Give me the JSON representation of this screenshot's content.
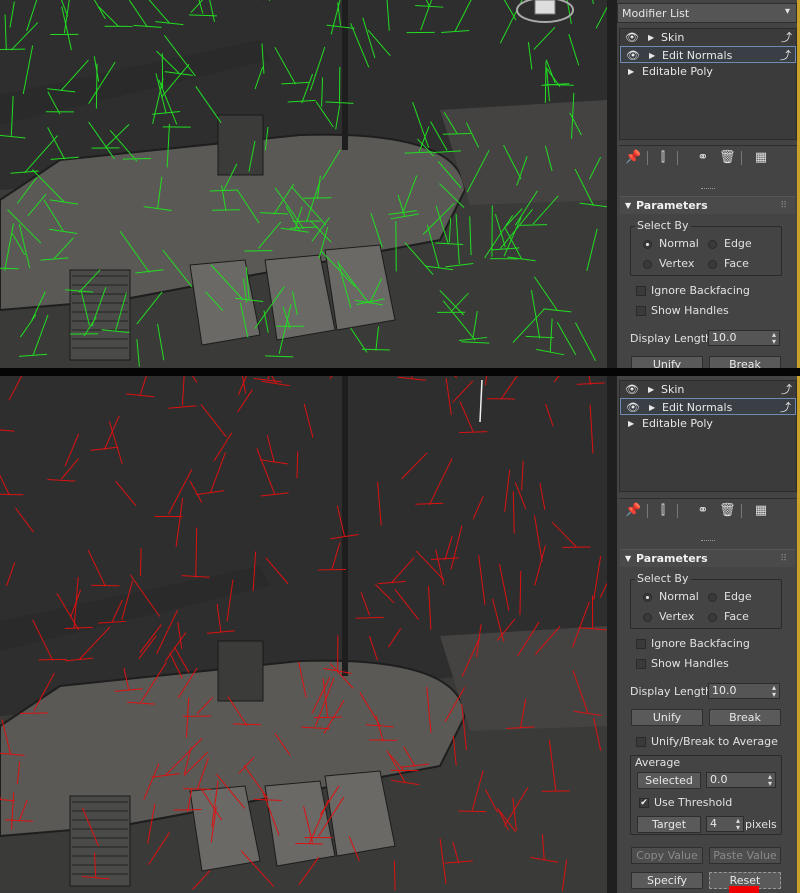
{
  "top_panel": {
    "modifier_list_label": "Modifier List",
    "stack": [
      {
        "label": "Skin"
      },
      {
        "label": "Edit Normals"
      },
      {
        "label": "Editable Poly"
      }
    ],
    "parameters": {
      "title": "Parameters",
      "select_by_label": "Select By",
      "radios": {
        "normal": "Normal",
        "edge": "Edge",
        "vertex": "Vertex",
        "face": "Face"
      },
      "ignore_backfacing": "Ignore Backfacing",
      "show_handles": "Show Handles",
      "display_length_label": "Display Length:",
      "display_length_value": "10.0",
      "unify_label": "Unify",
      "break_label": "Break"
    },
    "normals_color": "#22dd22"
  },
  "bottom_panel": {
    "stack": [
      {
        "label": "Skin"
      },
      {
        "label": "Edit Normals"
      },
      {
        "label": "Editable Poly"
      }
    ],
    "parameters": {
      "title": "Parameters",
      "select_by_label": "Select By",
      "radios": {
        "normal": "Normal",
        "edge": "Edge",
        "vertex": "Vertex",
        "face": "Face"
      },
      "ignore_backfacing": "Ignore Backfacing",
      "show_handles": "Show Handles",
      "display_length_label": "Display Length:",
      "display_length_value": "10.0",
      "unify_label": "Unify",
      "break_label": "Break",
      "unify_break_average": "Unify/Break to Average",
      "average_label": "Average",
      "selected_label": "Selected",
      "selected_value": "0.0",
      "use_threshold": "Use Threshold",
      "target_label": "Target",
      "target_value": "4",
      "pixels_label": "pixels",
      "copy_value_label": "Copy Value",
      "paste_value_label": "Paste Value",
      "specify_label": "Specify",
      "reset_label": "Reset"
    },
    "normals_color": "#dd1111"
  },
  "icons": [
    "eye-icon",
    "play-triangle-icon",
    "pin-icon",
    "pipe-icon",
    "unique-icon",
    "trash-icon",
    "configure-icon",
    "viewcube-icon"
  ],
  "accent_color": "#c9a227"
}
